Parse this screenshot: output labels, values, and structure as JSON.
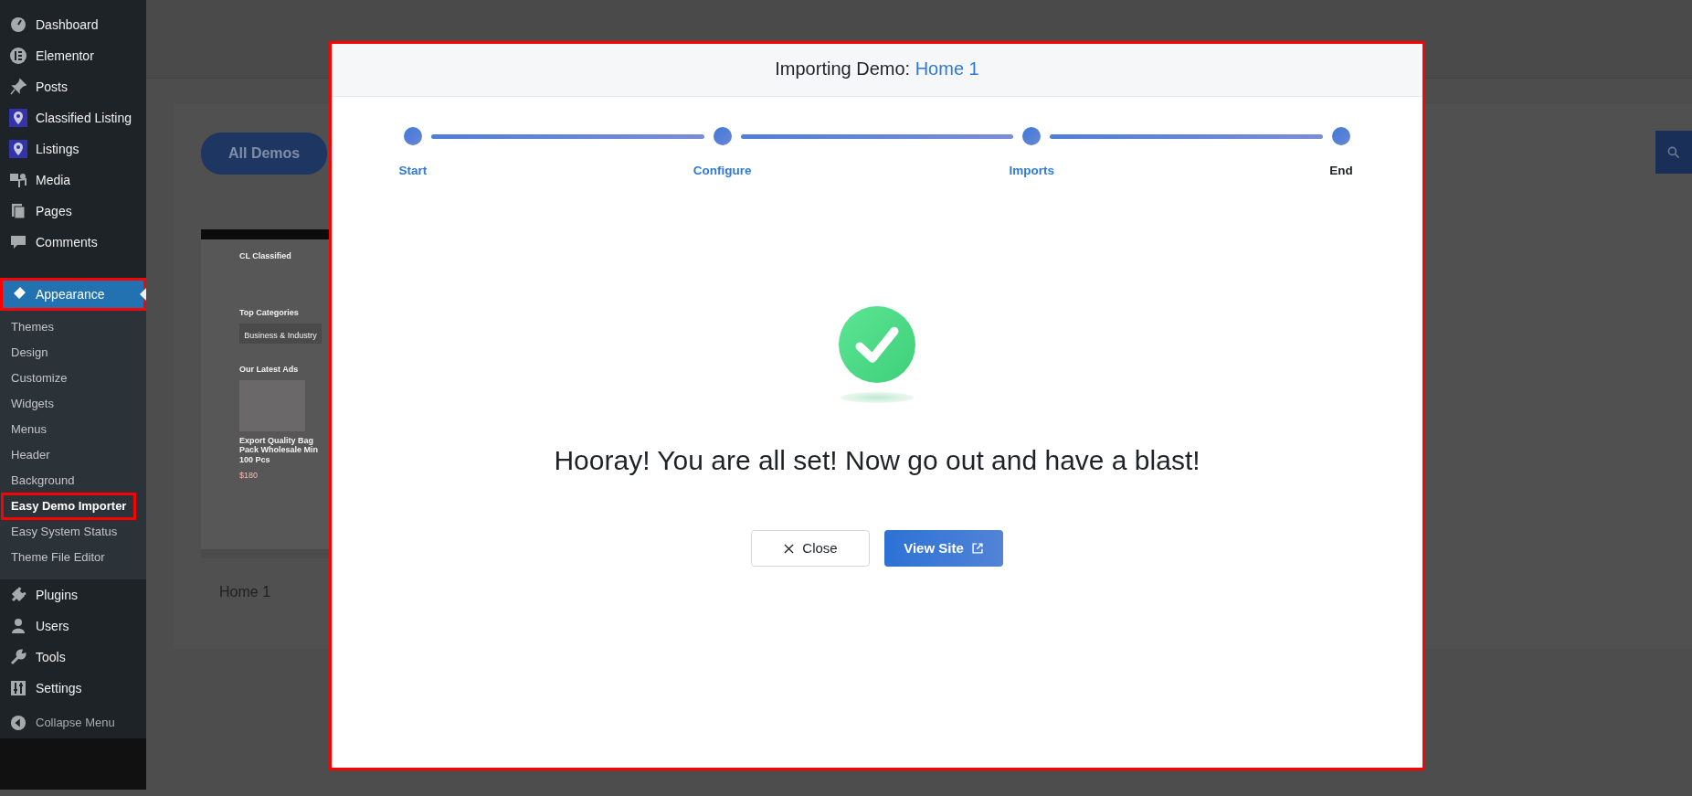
{
  "sidebar": {
    "items": [
      {
        "label": "Dashboard",
        "selected": false,
        "highlighted": false
      },
      {
        "label": "Elementor",
        "selected": false,
        "highlighted": false
      },
      {
        "label": "Posts",
        "selected": false,
        "highlighted": false
      },
      {
        "label": "Classified Listing",
        "selected": false,
        "highlighted": false
      },
      {
        "label": "Listings",
        "selected": false,
        "highlighted": false
      },
      {
        "label": "Media",
        "selected": false,
        "highlighted": false
      },
      {
        "label": "Pages",
        "selected": false,
        "highlighted": false
      },
      {
        "label": "Comments",
        "selected": false,
        "highlighted": false
      },
      {
        "label": "Appearance",
        "selected": true,
        "highlighted": true,
        "children": [
          {
            "label": "Themes",
            "selected": false,
            "highlighted": false
          },
          {
            "label": "Design",
            "selected": false,
            "highlighted": false
          },
          {
            "label": "Customize",
            "selected": false,
            "highlighted": false
          },
          {
            "label": "Widgets",
            "selected": false,
            "highlighted": false
          },
          {
            "label": "Menus",
            "selected": false,
            "highlighted": false
          },
          {
            "label": "Header",
            "selected": false,
            "highlighted": false
          },
          {
            "label": "Background",
            "selected": false,
            "highlighted": false
          },
          {
            "label": "Easy Demo Importer",
            "selected": true,
            "highlighted": true
          },
          {
            "label": "Easy System Status",
            "selected": false,
            "highlighted": false
          },
          {
            "label": "Theme File Editor",
            "selected": false,
            "highlighted": false
          }
        ]
      },
      {
        "label": "Plugins",
        "selected": false,
        "highlighted": false
      },
      {
        "label": "Users",
        "selected": false,
        "highlighted": false
      },
      {
        "label": "Tools",
        "selected": false,
        "highlighted": false
      },
      {
        "label": "Settings",
        "selected": false,
        "highlighted": false
      }
    ],
    "collapse_label": "Collapse Menu"
  },
  "page": {
    "filter_button": "All Demos",
    "demo_card": {
      "name": "Home 1",
      "preview": {
        "site_name": "CL Classified",
        "section_1": "Top Categories",
        "category": "Business & Industry",
        "section_2": "Our Latest Ads",
        "ad_title": "Export Quality Bag Pack Wholesale Min 100 Pcs",
        "ad_price": "$180"
      }
    }
  },
  "modal": {
    "title": "Importing Demo:",
    "demo_name": "Home 1",
    "highlighted": true,
    "steps": [
      {
        "label": "Start",
        "done": true
      },
      {
        "label": "Configure",
        "done": true
      },
      {
        "label": "Imports",
        "done": true
      },
      {
        "label": "End",
        "done": false
      }
    ],
    "message": "Hooray! You are all set! Now go out and have a blast!",
    "buttons": [
      {
        "kind": "close",
        "label": "Close"
      },
      {
        "kind": "view",
        "label": "View Site"
      }
    ]
  }
}
